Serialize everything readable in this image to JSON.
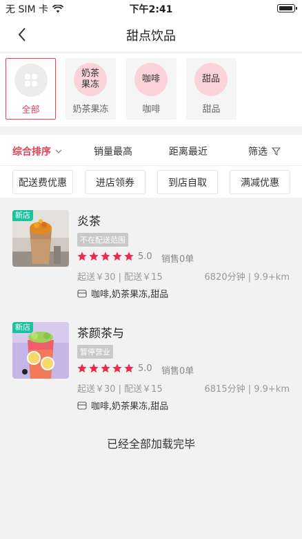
{
  "status": {
    "carrier": "无 SIM 卡",
    "time": "下午2:41"
  },
  "nav": {
    "title": "甜点饮品"
  },
  "categories": [
    {
      "name": "全部",
      "icon": "grid-icon",
      "active": true
    },
    {
      "name": "奶茶果冻",
      "circle_text": "奶茶果冻",
      "active": false
    },
    {
      "name": "咖啡",
      "circle_text": "咖啡",
      "active": false
    },
    {
      "name": "甜品",
      "circle_text": "甜品",
      "active": false
    }
  ],
  "sort": [
    {
      "label": "综合排序",
      "active": true,
      "icon": "chevron-down-icon"
    },
    {
      "label": "销量最高",
      "active": false
    },
    {
      "label": "距离最近",
      "active": false
    },
    {
      "label": "筛选",
      "active": false,
      "icon": "filter-icon"
    }
  ],
  "filters": [
    "配送费优惠",
    "进店领券",
    "到店自取",
    "满减优惠"
  ],
  "stores": [
    {
      "badge": "新店",
      "name": "炎茶",
      "status_tag": "不在配送范围",
      "stars": 5,
      "rating": "5.0",
      "sales": "销售0单",
      "fee": "起送￥30 | 配送￥15",
      "distance": "6820分钟 | 9.9+km",
      "categories": "咖啡,奶茶果冻,甜品"
    },
    {
      "badge": "新店",
      "name": "茶颜茶与",
      "status_tag": "暂停营业",
      "stars": 5,
      "rating": "5.0",
      "sales": "销售0单",
      "fee": "起送￥30 | 配送￥15",
      "distance": "6815分钟 | 9.9+km",
      "categories": "咖啡,奶茶果冻,甜品"
    }
  ],
  "footer": {
    "end_text": "已经全部加载完毕"
  },
  "colors": {
    "accent": "#e04055",
    "star": "#f0294a",
    "badge": "#19c3a0"
  }
}
